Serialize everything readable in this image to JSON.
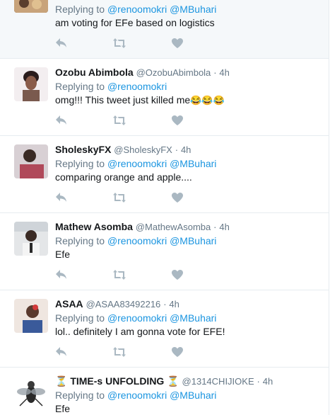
{
  "replying_to_label": "Replying to",
  "tweets": [
    {
      "name": "",
      "handle": "",
      "time": "",
      "mentions": [
        "@renoomokri",
        "@MBuhari"
      ],
      "text": "am voting for EFe based on logistics",
      "avatar_color": "#8a6a4a"
    },
    {
      "name": "Ozobu Abimbola",
      "handle": "@OzobuAbimbola",
      "time": "4h",
      "mentions": [
        "@renoomokri"
      ],
      "text": "omg!!! This tweet just killed me",
      "text_emoji": "😂😂😂",
      "avatar_color": "#7a5a4e"
    },
    {
      "name": "SholeskyFX",
      "handle": "@SholeskyFX",
      "time": "4h",
      "mentions": [
        "@renoomokri",
        "@MBuhari"
      ],
      "text": "comparing orange and apple....",
      "avatar_color": "#b0495a"
    },
    {
      "name": "Mathew Asomba",
      "handle": "@MathewAsomba",
      "time": "4h",
      "mentions": [
        "@renoomokri",
        "@MBuhari"
      ],
      "text": "Efe",
      "avatar_color": "#cfd4d9"
    },
    {
      "name": "ASAA",
      "handle": "@ASAA83492216",
      "time": "4h",
      "mentions": [
        "@renoomokri",
        "@MBuhari"
      ],
      "text": "lol.. definitely I am gonna vote for EFE!",
      "avatar_color": "#d9b8a6"
    },
    {
      "name": "TIME-s UNFOLDING",
      "name_prefix": "⏳",
      "name_suffix": "⏳",
      "handle": "@1314CHIJIOKE",
      "time": "4h",
      "mentions": [
        "@renoomokri",
        "@MBuhari"
      ],
      "text": "Efe",
      "avatar_color": "#e8e8e8"
    }
  ],
  "separator": "·",
  "icons": {
    "reply": "reply-icon",
    "retweet": "retweet-icon",
    "like": "heart-icon"
  },
  "colors": {
    "mention": "#1b95e0",
    "secondary_text": "#657786",
    "action_icon": "#aab8c2"
  }
}
